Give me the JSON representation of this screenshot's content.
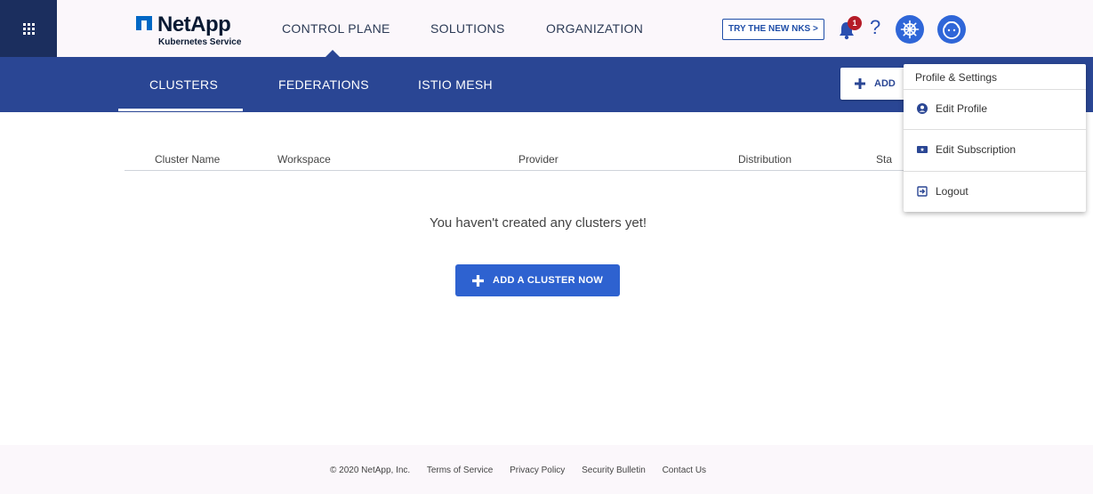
{
  "header": {
    "logo_name": "NetApp",
    "logo_subtitle": "Kubernetes Service",
    "nav": [
      "CONTROL PLANE",
      "SOLUTIONS",
      "ORGANIZATION"
    ],
    "active_nav": "CONTROL PLANE",
    "try_button_label": "TRY THE NEW NKS >",
    "notification_count": "1",
    "help_label": "?",
    "icons": [
      "apps-grid-icon",
      "bell-icon",
      "help-icon",
      "helm-wheel-icon",
      "avatar-icon"
    ]
  },
  "subnav": {
    "tabs": [
      "CLUSTERS",
      "FEDERATIONS",
      "ISTIO MESH"
    ],
    "active_tab": "CLUSTERS",
    "add_button_label": "ADD"
  },
  "table": {
    "columns": [
      "Cluster Name",
      "Workspace",
      "Provider",
      "Distribution",
      "Sta"
    ]
  },
  "main": {
    "empty_message": "You haven't created any clusters yet!",
    "add_now_label": "ADD A CLUSTER NOW"
  },
  "profile_menu": {
    "title": "Profile & Settings",
    "items": [
      {
        "label": "Edit Profile",
        "icon": "user-circle-icon"
      },
      {
        "label": "Edit Subscription",
        "icon": "ticket-icon"
      },
      {
        "label": "Logout",
        "icon": "sign-out-icon"
      }
    ]
  },
  "footer": {
    "copyright": "© 2020 NetApp, Inc.",
    "links": [
      "Terms of Service",
      "Privacy Policy",
      "Security Bulletin",
      "Contact Us"
    ]
  },
  "colors": {
    "header_bg": "#fbf7fb",
    "apps_bg": "#1b2e5e",
    "subnav_bg": "#2a4694",
    "primary_button": "#2e62d0",
    "badge": "#b51c28"
  }
}
